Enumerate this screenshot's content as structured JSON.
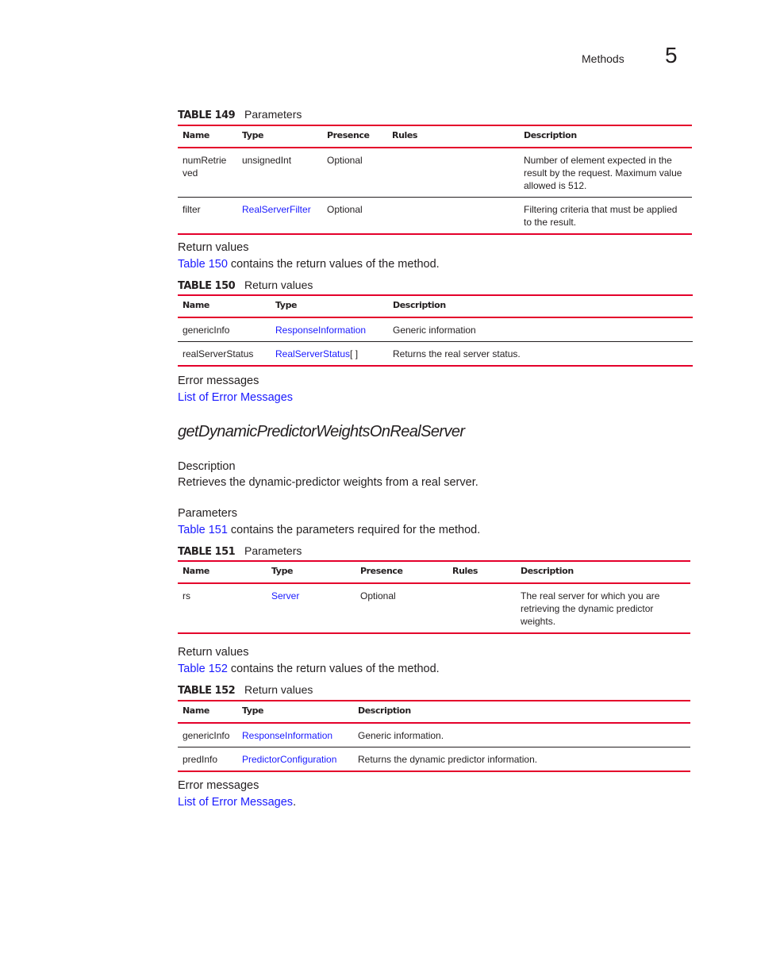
{
  "header": {
    "section": "Methods",
    "chapter": "5"
  },
  "table149": {
    "number": "TABLE 149",
    "title": "Parameters",
    "columns": [
      "Name",
      "Type",
      "Presence",
      "Rules",
      "Description"
    ],
    "rows": [
      {
        "name": "numRetrie ved",
        "type": "unsignedInt",
        "type_is_link": false,
        "presence": "Optional",
        "rules": "",
        "description": "Number of element expected in the result by the request. Maximum value allowed is 512."
      },
      {
        "name": "filter",
        "type": "RealServerFilter",
        "type_is_link": true,
        "presence": "Optional",
        "rules": "",
        "description": "Filtering criteria that must be applied to the result."
      }
    ]
  },
  "return_values_1": {
    "heading": "Return values",
    "link": "Table 150",
    "text": " contains the return values of the method."
  },
  "table150": {
    "number": "TABLE 150",
    "title": "Return values",
    "columns": [
      "Name",
      "Type",
      "Description"
    ],
    "rows": [
      {
        "name": "genericInfo",
        "type": "ResponseInformation",
        "type_suffix": "",
        "description": "Generic information"
      },
      {
        "name": "realServerStatus",
        "type": "RealServerStatus",
        "type_suffix": "[ ]",
        "description": "Returns the real server status."
      }
    ]
  },
  "error_messages_1": {
    "heading": "Error messages",
    "link": "List of Error Messages",
    "suffix": ""
  },
  "method": {
    "title": "getDynamicPredictorWeightsOnRealServer",
    "description_heading": "Description",
    "description": "Retrieves the dynamic-predictor weights from a real server.",
    "parameters_heading": "Parameters",
    "parameters_link": "Table 151",
    "parameters_text": " contains the parameters required for the method."
  },
  "table151": {
    "number": "TABLE 151",
    "title": "Parameters",
    "columns": [
      "Name",
      "Type",
      "Presence",
      "Rules",
      "Description"
    ],
    "rows": [
      {
        "name": "rs",
        "type": "Server",
        "presence": "Optional",
        "rules": "",
        "description": "The real server for which you are retrieving the dynamic predictor weights."
      }
    ]
  },
  "return_values_2": {
    "heading": "Return values",
    "link": "Table 152",
    "text": " contains the return values of the method."
  },
  "table152": {
    "number": "TABLE 152",
    "title": "Return values",
    "columns": [
      "Name",
      "Type",
      "Description"
    ],
    "rows": [
      {
        "name": "genericInfo",
        "type": "ResponseInformation",
        "description": "Generic information."
      },
      {
        "name": "predInfo",
        "type": "PredictorConfiguration",
        "description": "Returns the dynamic predictor information."
      }
    ]
  },
  "error_messages_2": {
    "heading": "Error messages",
    "link": "List of Error Messages",
    "suffix": "."
  },
  "colors": {
    "rule_red": "#e4002b",
    "link_blue": "#1a1aff",
    "text": "#231f20"
  }
}
